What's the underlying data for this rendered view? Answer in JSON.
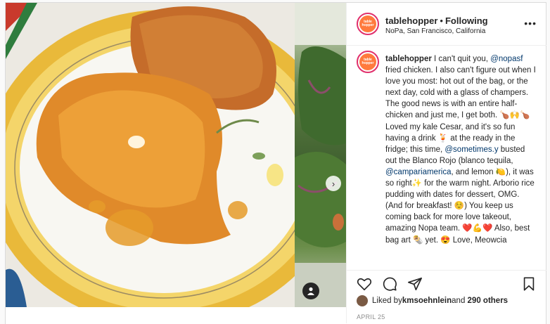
{
  "header": {
    "username": "tablehopper",
    "separator": "•",
    "follow_status": "Following",
    "location": "NoPa, San Francisco, California",
    "more": "•••"
  },
  "logo": {
    "line1": "table",
    "line2": "hopper"
  },
  "caption": {
    "username": "tablehopper",
    "t1": " I can't quit you, ",
    "m1": "@nopasf",
    "t2": " fried chicken. I also can't figure out when I love you most: hot out of the bag, or the next day, cold with a glass of champers. The good news is with an entire half-chicken and just me, I get both. 🍗🙌🍗 Loved my kale Cesar, and it's so fun having a drink 🍹 at the ready in the fridge; this time, ",
    "m2": "@sometimes.y",
    "t3": " busted out the Blanco Rojo (blanco tequila, ",
    "m3": "@campariamerica",
    "t4": ", and lemon 🍋), it was so right✨ for the warm night. Arborio rice pudding with dates for dessert, OMG. (And for breakfast! ☺️) You keep us coming back for more love takeout, amazing Nopa team. ❤️💪❤️ Also, best bag art 🌯 yet. 😍 Love, Meowcia"
  },
  "likes": {
    "prefix": "Liked by ",
    "user": "kmsoehnlein",
    "middle": " and ",
    "count": "290 others"
  },
  "date": "APRIL 25",
  "media": {
    "nav_arrow": "›"
  },
  "colors": {
    "accent": "#e1306c",
    "mention": "#00376b",
    "plate_rim": "#f0c43a"
  }
}
